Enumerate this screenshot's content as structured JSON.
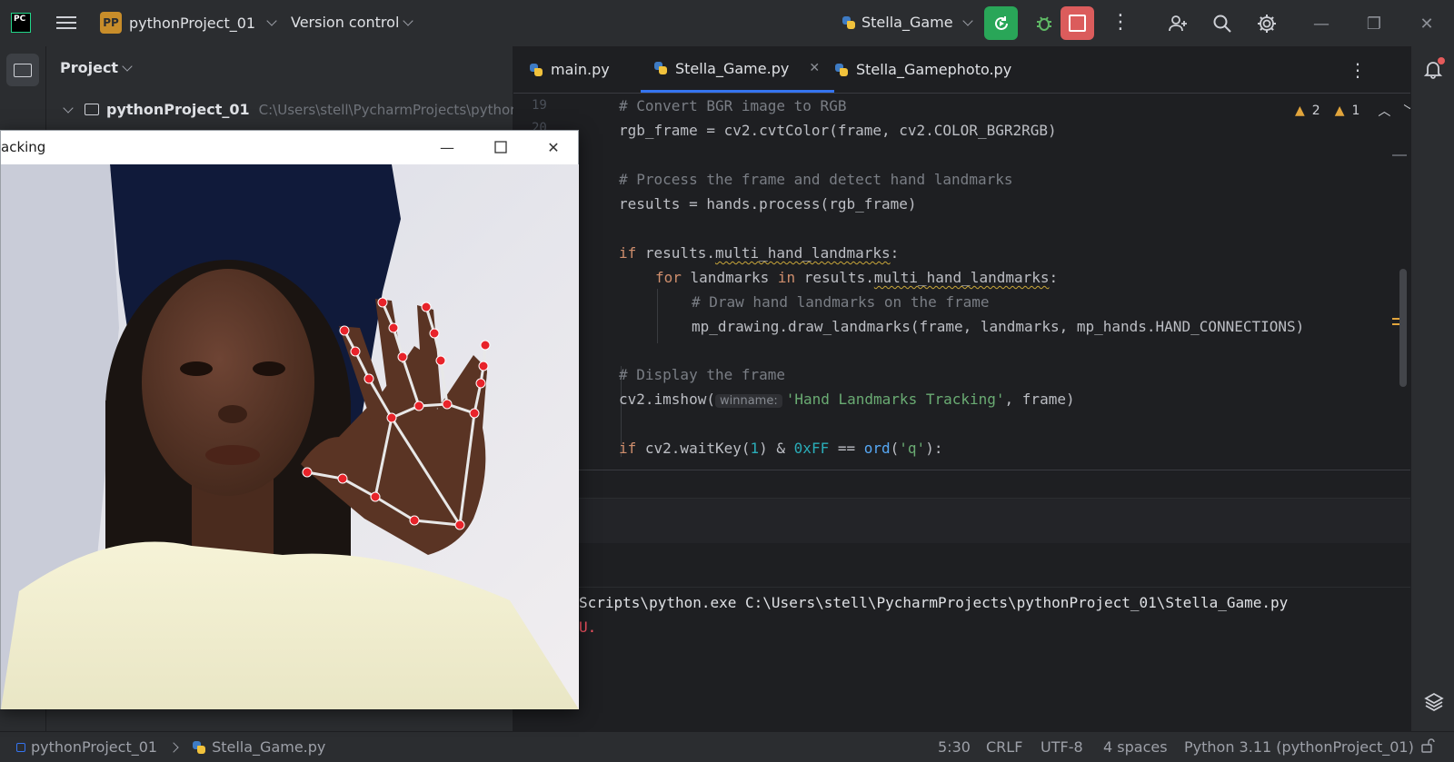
{
  "titlebar": {
    "logo_text": "PC",
    "project_badge": "PP",
    "project_name": "pythonProject_01",
    "version_control": "Version control",
    "run_config": "Stella_Game"
  },
  "project_panel": {
    "title": "Project",
    "root_name": "pythonProject_01",
    "root_path": "C:\\Users\\stell\\PycharmProjects\\pythonP"
  },
  "tabs": [
    {
      "label": "main.py"
    },
    {
      "label": "Stella_Game.py"
    },
    {
      "label": "Stella_Gamephoto.py"
    }
  ],
  "editor": {
    "line_numbers": [
      "19",
      "20"
    ],
    "inspections": {
      "warnings": "2",
      "weak_warnings": "1"
    },
    "lines": {
      "l1": "# Convert BGR image to RGB",
      "l2": "rgb_frame = cv2.cvtColor(frame, cv2.COLOR_BGR2RGB)",
      "l3": "# Process the frame and detect hand landmarks",
      "l4": "results = hands.process(rgb_frame)",
      "l5_kw": "if",
      "l5_a": " results.",
      "l5_b": "multi_hand_landmarks",
      "l5_c": ":",
      "l6_kw": "for",
      "l6_a": " landmarks ",
      "l6_in": "in",
      "l6_b": " results.",
      "l6_c": "multi_hand_landmarks",
      "l6_d": ":",
      "l7": "# Draw hand landmarks on the frame",
      "l8": "mp_drawing.draw_landmarks(frame, landmarks, mp_hands.HAND_CONNECTIONS)",
      "l9": "# Display the frame",
      "l10_a": "cv2.imshow(",
      "l10_hint": "winname:",
      "l10_str": "'Hand Landmarks Tracking'",
      "l10_b": ", frame)",
      "l11_kw": "if",
      "l11_a": " cv2.waitKey(",
      "l11_num1": "1",
      "l11_b": ") & ",
      "l11_num2": "0xFF",
      "l11_c": " == ",
      "l11_ord": "ord",
      "l11_d": "(",
      "l11_str": "'q'",
      "l11_e": "):"
    }
  },
  "console": {
    "line1": "Scripts\\python.exe C:\\Users\\stell\\PycharmProjects\\pythonProject_01\\Stella_Game.py",
    "line2": "U."
  },
  "cv_window": {
    "title": "acking"
  },
  "statusbar": {
    "project": "pythonProject_01",
    "file": "Stella_Game.py",
    "position": "5:30",
    "line_sep": "CRLF",
    "encoding": "UTF-8",
    "indent": "4 spaces",
    "interpreter": "Python 3.11 (pythonProject_01)"
  },
  "colors": {
    "accent": "#3574f0",
    "run_green": "#29a658",
    "stop_red": "#db5c5c",
    "keyword": "#cf8e6d",
    "string": "#6aab73",
    "comment": "#7a7e85",
    "landmark": "#e8232a"
  },
  "icons": [
    "menu-icon",
    "rerun-icon",
    "debug-icon",
    "stop-icon",
    "more-icon",
    "add-user-icon",
    "search-icon",
    "gear-icon",
    "minimize-icon",
    "restore-icon",
    "close-icon",
    "folder-icon",
    "bell-icon",
    "layers-icon",
    "python-file-icon"
  ]
}
